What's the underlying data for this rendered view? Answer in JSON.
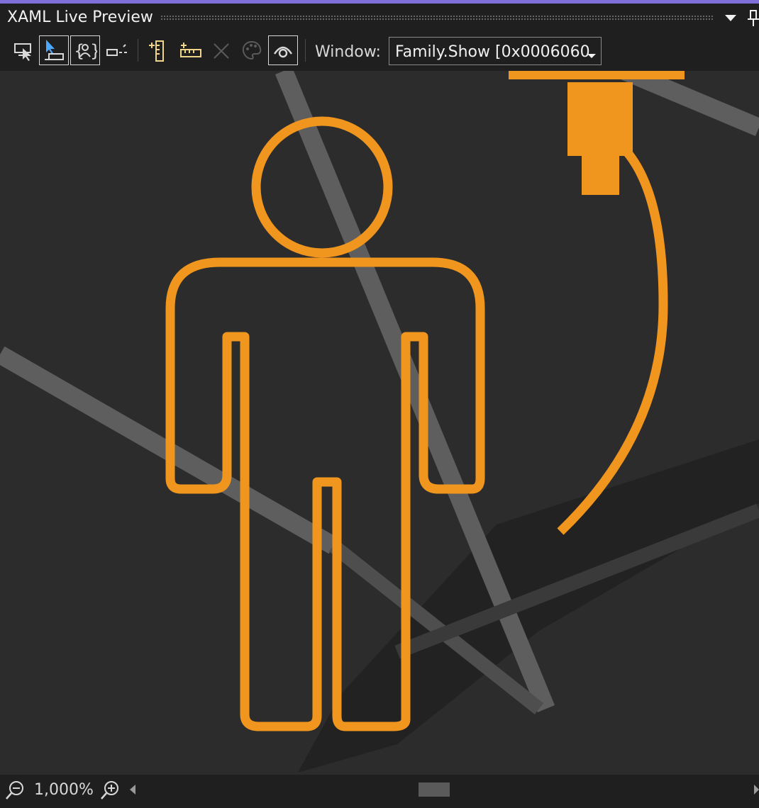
{
  "panel": {
    "title": "XAML Live Preview",
    "menu_icon": "dropdown-triangle-icon",
    "pin_icon": "pin-icon"
  },
  "toolbar": {
    "buttons": [
      {
        "name": "select-element-in-running-app",
        "icon": "cursor-select-icon",
        "active": false
      },
      {
        "name": "display-layout-adorners",
        "icon": "layout-adorner-icon",
        "active": true
      },
      {
        "name": "track-focused-element",
        "icon": "track-focus-icon",
        "active": true
      },
      {
        "name": "display-layout-rulers",
        "icon": "baseline-icon",
        "active": false
      },
      {
        "name": "vertical-ruler",
        "icon": "vertical-ruler-icon",
        "active": false
      },
      {
        "name": "horizontal-ruler",
        "icon": "horizontal-ruler-icon",
        "active": false
      },
      {
        "name": "clear-rulers",
        "icon": "close-icon",
        "active": false
      },
      {
        "name": "color-picker",
        "icon": "palette-icon",
        "active": false
      },
      {
        "name": "preview-visibility",
        "icon": "eye-icon",
        "active": true
      }
    ],
    "window_label": "Window:",
    "window_value": "Family.Show [0x0006060"
  },
  "statusbar": {
    "zoom_level": "1,000%"
  },
  "colors": {
    "accent_top": "#7f6fd8",
    "adorner_orange": "#f0961e",
    "panel_bg": "#1f1f1f",
    "canvas_bg": "#2c2c2c"
  }
}
